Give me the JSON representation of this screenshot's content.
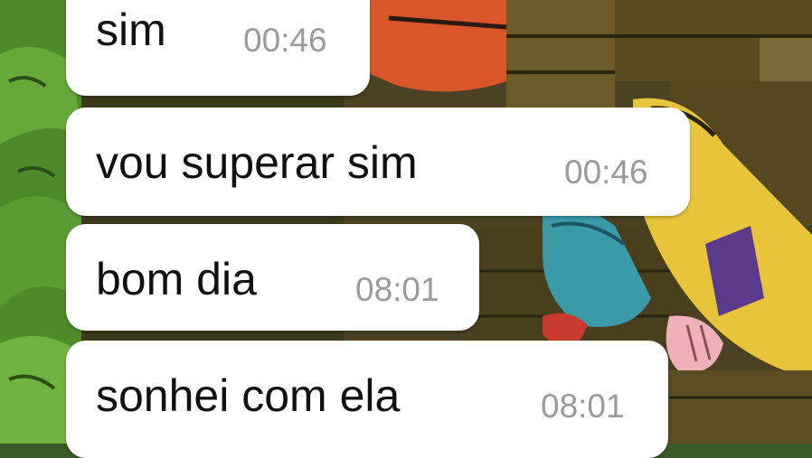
{
  "messages": [
    {
      "text": "sim",
      "time": "00:46"
    },
    {
      "text": "vou superar sim",
      "time": "00:46"
    },
    {
      "text": "bom dia",
      "time": "08:01"
    },
    {
      "text": "sonhei com ela",
      "time": "08:01"
    }
  ]
}
